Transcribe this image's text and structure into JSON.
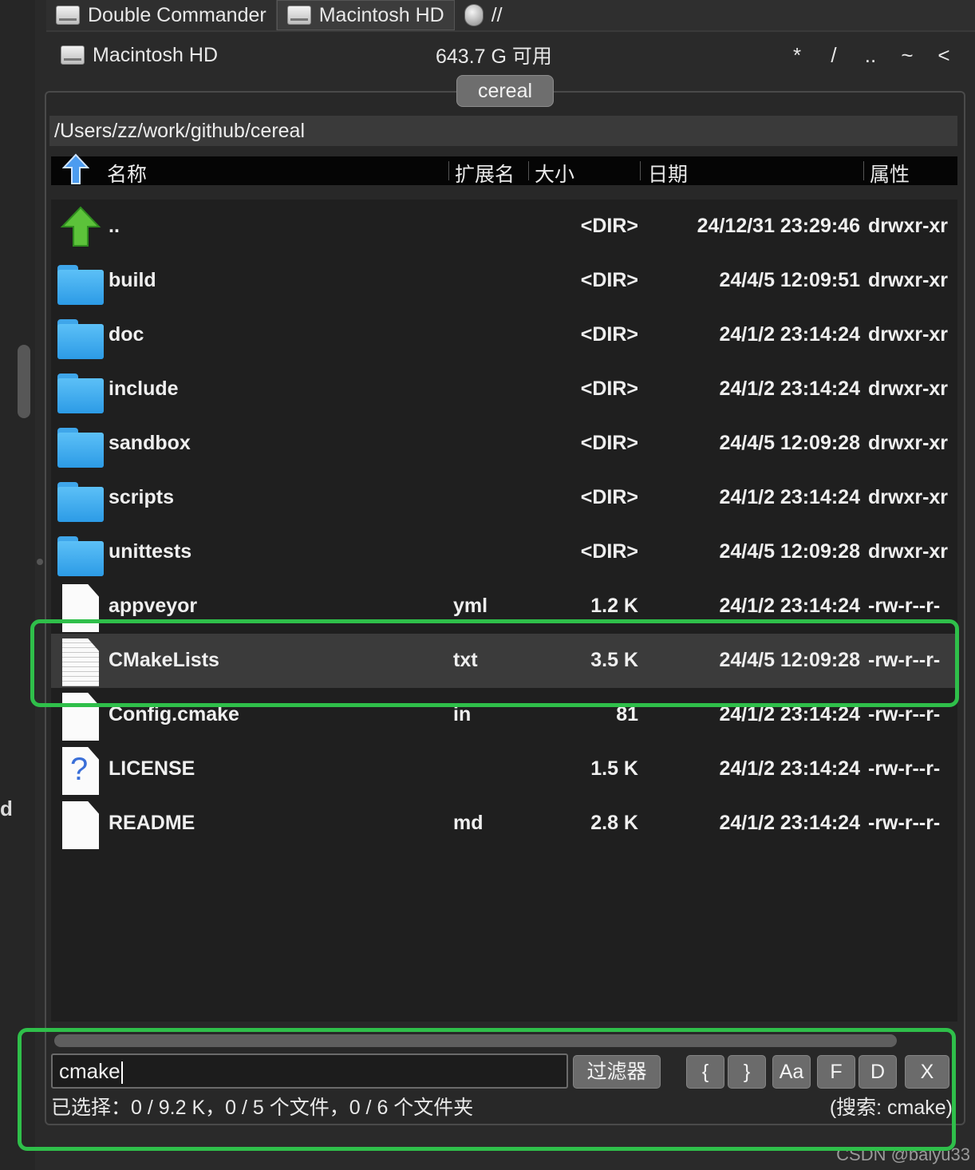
{
  "drive_tabs": [
    {
      "label": "Double Commander",
      "icon": "hard-drive-icon"
    },
    {
      "label": "Macintosh HD",
      "icon": "hard-drive-icon"
    },
    {
      "label": "//",
      "icon": "network-icon"
    }
  ],
  "drive_info": {
    "name": "Macintosh HD",
    "free": "643.7 G 可用",
    "quick_buttons": [
      "*",
      "/",
      "..",
      "~",
      "<"
    ]
  },
  "panel_tab": "cereal",
  "path": "/Users/zz/work/github/cereal",
  "columns": {
    "name": "名称",
    "ext": "扩展名",
    "size": "大小",
    "date": "日期",
    "attr": "属性"
  },
  "files": [
    {
      "name": "..",
      "ext": "",
      "size": "<DIR>",
      "date": "24/12/31 23:29:46",
      "attr": "drwxr-xr",
      "type": "parent"
    },
    {
      "name": "build",
      "ext": "",
      "size": "<DIR>",
      "date": "24/4/5 12:09:51",
      "attr": "drwxr-xr",
      "type": "folder"
    },
    {
      "name": "doc",
      "ext": "",
      "size": "<DIR>",
      "date": "24/1/2 23:14:24",
      "attr": "drwxr-xr",
      "type": "folder"
    },
    {
      "name": "include",
      "ext": "",
      "size": "<DIR>",
      "date": "24/1/2 23:14:24",
      "attr": "drwxr-xr",
      "type": "folder"
    },
    {
      "name": "sandbox",
      "ext": "",
      "size": "<DIR>",
      "date": "24/4/5 12:09:28",
      "attr": "drwxr-xr",
      "type": "folder"
    },
    {
      "name": "scripts",
      "ext": "",
      "size": "<DIR>",
      "date": "24/1/2 23:14:24",
      "attr": "drwxr-xr",
      "type": "folder"
    },
    {
      "name": "unittests",
      "ext": "",
      "size": "<DIR>",
      "date": "24/4/5 12:09:28",
      "attr": "drwxr-xr",
      "type": "folder"
    },
    {
      "name": "appveyor",
      "ext": "yml",
      "size": "1.2 K",
      "date": "24/1/2 23:14:24",
      "attr": "-rw-r--r-",
      "type": "file"
    },
    {
      "name": "CMakeLists",
      "ext": "txt",
      "size": "3.5 K",
      "date": "24/4/5 12:09:28",
      "attr": "-rw-r--r-",
      "type": "text",
      "selected": true
    },
    {
      "name": "Config.cmake",
      "ext": "in",
      "size": "81",
      "date": "24/1/2 23:14:24",
      "attr": "-rw-r--r-",
      "type": "file"
    },
    {
      "name": "LICENSE",
      "ext": "",
      "size": "1.5 K",
      "date": "24/1/2 23:14:24",
      "attr": "-rw-r--r-",
      "type": "unknown"
    },
    {
      "name": "README",
      "ext": "md",
      "size": "2.8 K",
      "date": "24/1/2 23:14:24",
      "attr": "-rw-r--r-",
      "type": "file"
    }
  ],
  "filter": {
    "value": "cmake",
    "button": "过滤器",
    "options": [
      "{",
      "}",
      "Aa",
      "F",
      "D"
    ],
    "close": "X"
  },
  "status": {
    "left": "已选择：0 / 9.2 K，0 / 5 个文件，0 / 6 个文件夹",
    "right": "(搜索: cmake)"
  },
  "left_edge_letter": "d",
  "watermark": "CSDN @baiyu33",
  "colors": {
    "highlight": "#2fbf4a",
    "folder": "#3fa6ea"
  }
}
